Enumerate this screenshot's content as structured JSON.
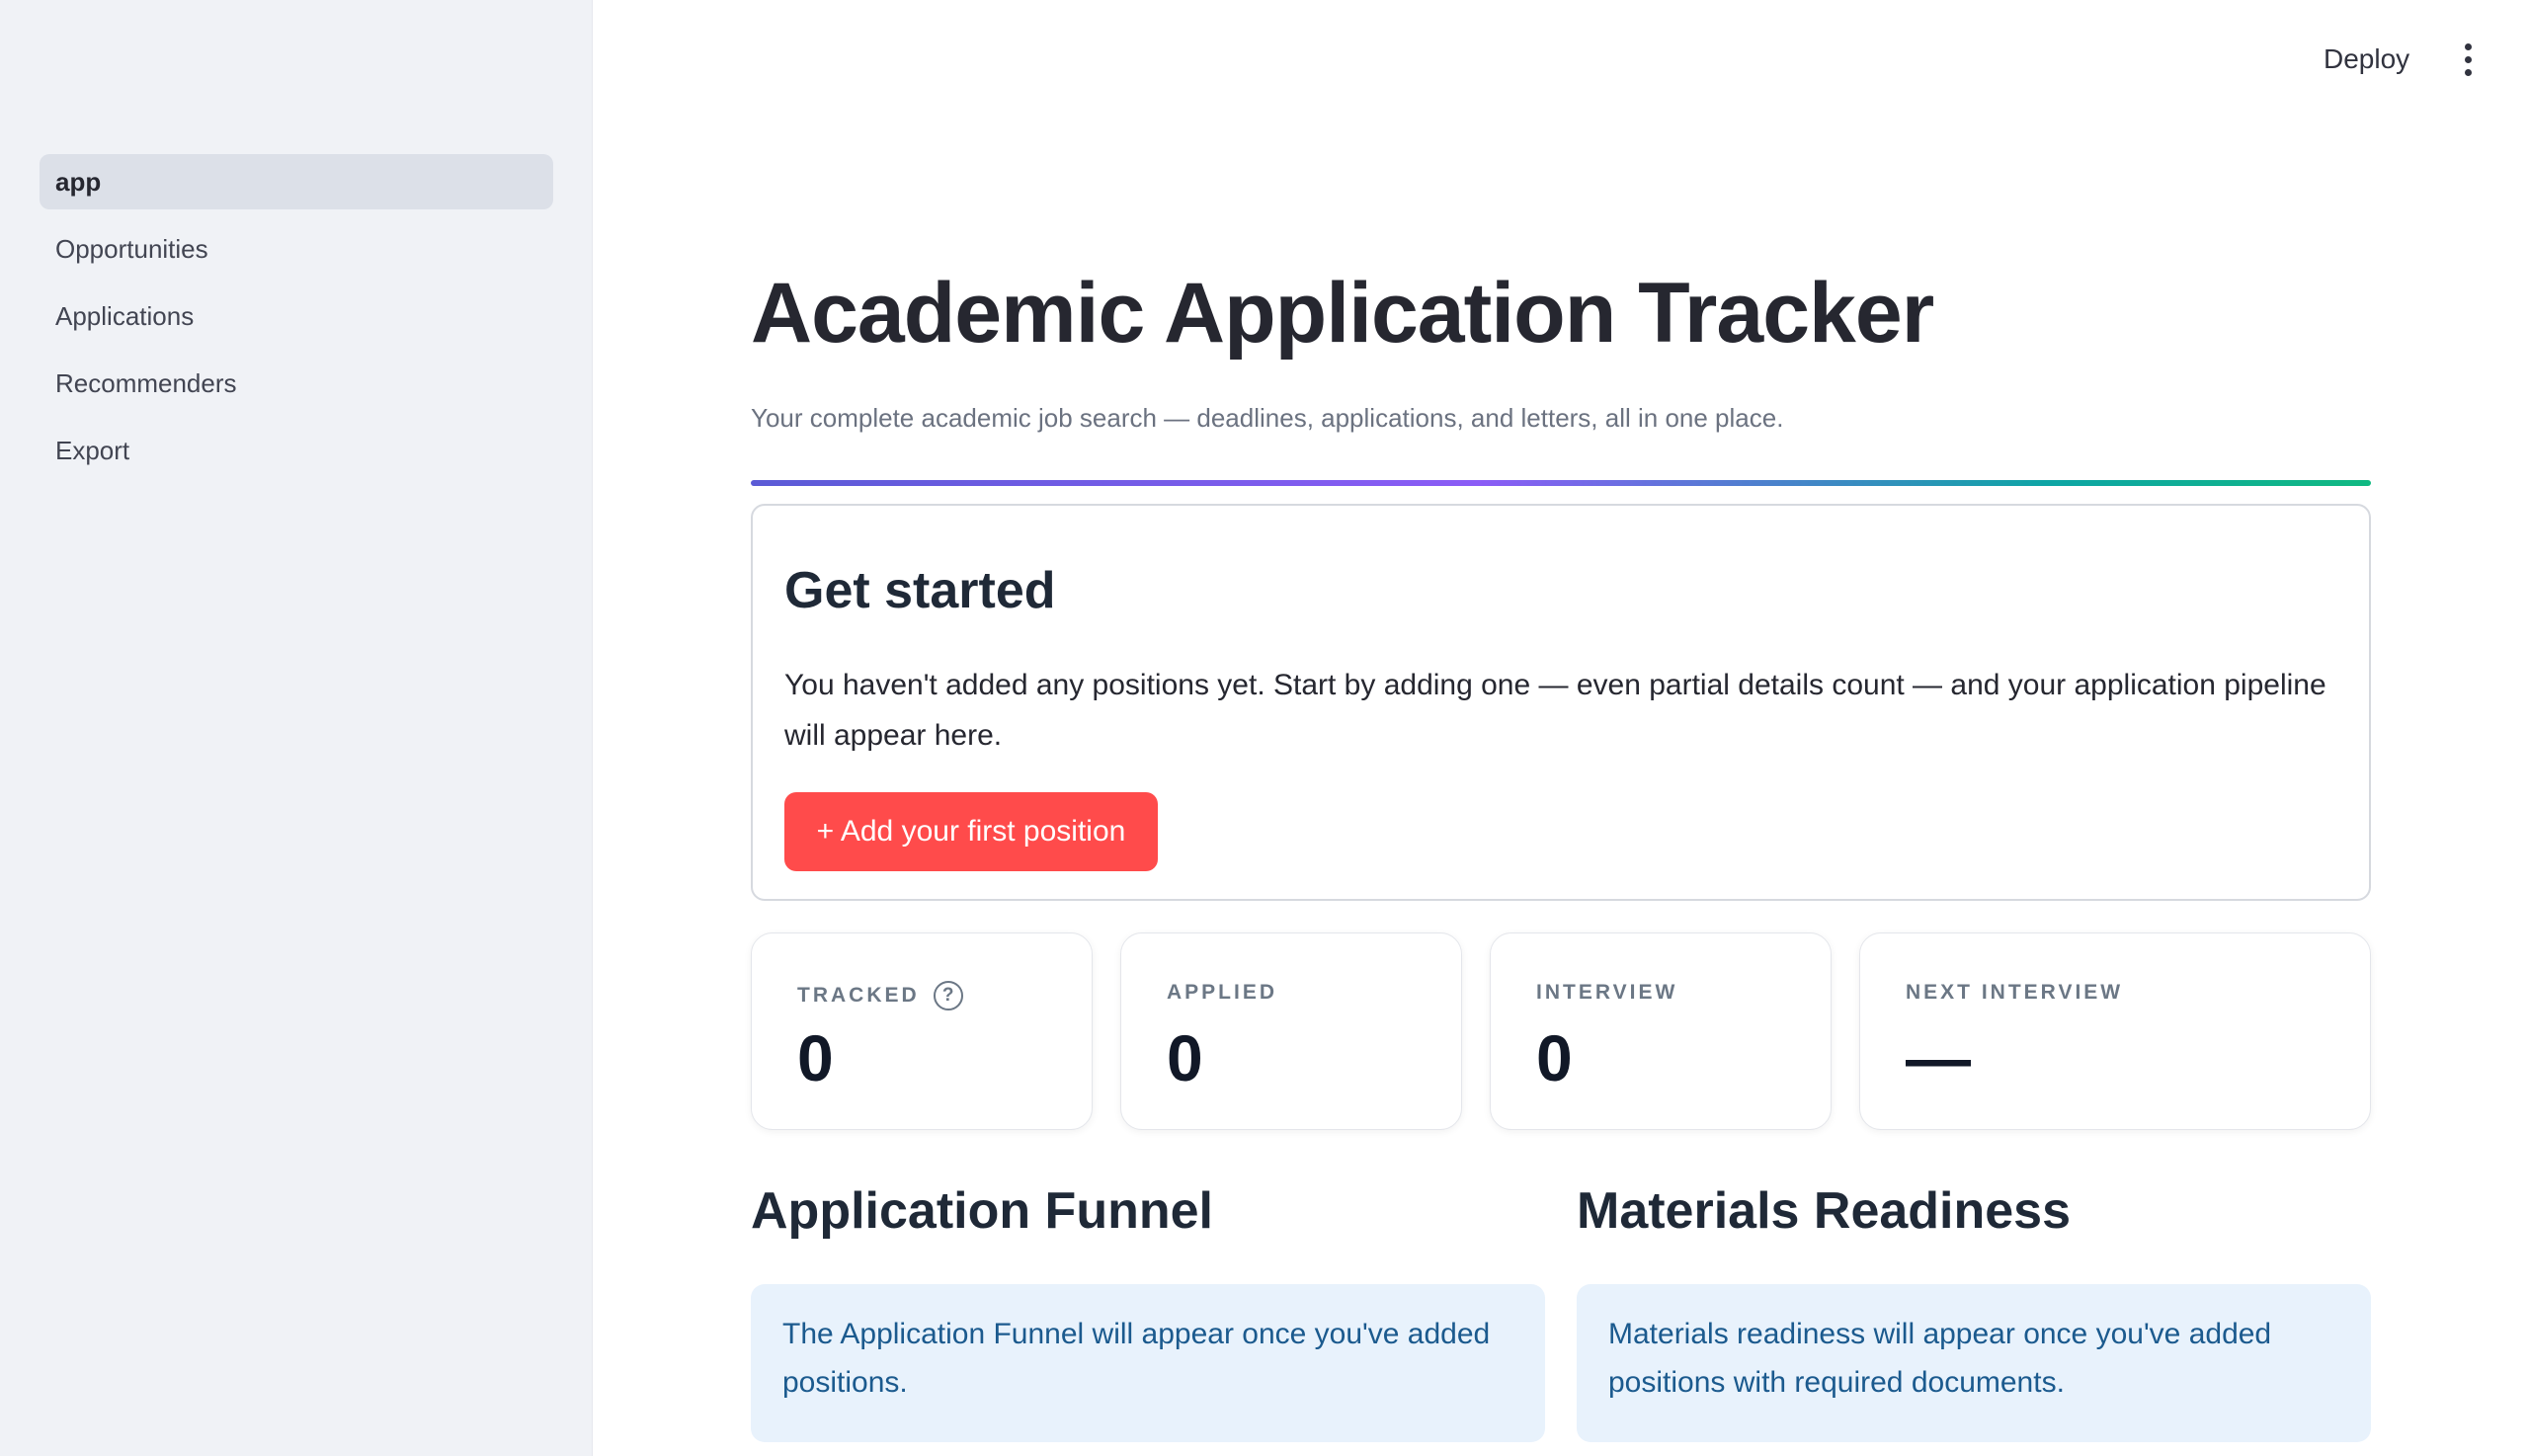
{
  "sidebar": {
    "items": [
      {
        "label": "app",
        "active": true
      },
      {
        "label": "Opportunities",
        "active": false
      },
      {
        "label": "Applications",
        "active": false
      },
      {
        "label": "Recommenders",
        "active": false
      },
      {
        "label": "Export",
        "active": false
      }
    ]
  },
  "header": {
    "deploy_label": "Deploy",
    "menu_icon": "vertical-ellipsis-icon"
  },
  "main": {
    "title": "Academic Application Tracker",
    "subtitle": "Your complete academic job search — deadlines, applications, and letters, all in one place.",
    "get_started": {
      "heading": "Get started",
      "body": "You haven't added any positions yet. Start by adding one — even partial details count — and your application pipeline will appear here.",
      "button_label": "+ Add your first position"
    },
    "metrics": [
      {
        "label": "TRACKED",
        "value": "0",
        "help_icon": "question-circle-icon"
      },
      {
        "label": "APPLIED",
        "value": "0"
      },
      {
        "label": "INTERVIEW",
        "value": "0"
      },
      {
        "label": "NEXT INTERVIEW",
        "value": "—"
      }
    ],
    "funnel": {
      "title": "Application Funnel",
      "info": "The Application Funnel will appear once you've added positions."
    },
    "materials": {
      "title": "Materials Readiness",
      "info": "Materials readiness will appear once you've added positions with required documents."
    }
  },
  "colors": {
    "primary_button": "#ff4b4b",
    "sidebar_bg": "#f0f2f6",
    "info_bg": "#e8f2fc",
    "info_text": "#1b5a8e"
  }
}
